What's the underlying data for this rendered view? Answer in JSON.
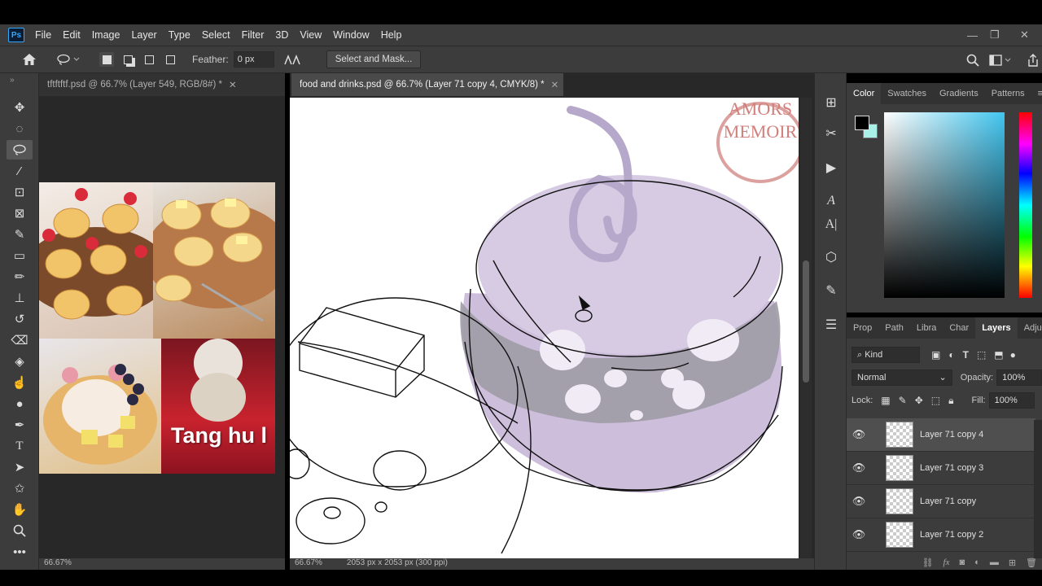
{
  "menubar": {
    "logo": "Ps",
    "items": [
      "File",
      "Edit",
      "Image",
      "Layer",
      "Type",
      "Select",
      "Filter",
      "3D",
      "View",
      "Window",
      "Help"
    ]
  },
  "options": {
    "feather_label": "Feather:",
    "feather_value": "0 px",
    "select_and_mask": "Select and Mask..."
  },
  "documents": {
    "doc1": {
      "tab_title": "tftftftf.psd @ 66.7% (Layer 549, RGB/8#) *",
      "photo_caption": "Tang hu l",
      "status_zoom": "66.67%"
    },
    "doc2": {
      "tab_title": "food and drinks.psd @ 66.7% (Layer 71 copy 4, CMYK/8) *",
      "status_zoom": "66.67%",
      "status_info": "2053 px x 2053 px (300 ppi)",
      "watermark_line1": "AMORS",
      "watermark_line2": "MEMOIR"
    }
  },
  "color_panel": {
    "tabs": [
      "Color",
      "Swatches",
      "Gradients",
      "Patterns"
    ],
    "active_tab": "Color",
    "foreground": "#000000",
    "background": "#a8f0e8"
  },
  "layers_panel": {
    "tabs": [
      "Prop",
      "Path",
      "Libra",
      "Char",
      "Layers",
      "Adjus"
    ],
    "active_tab": "Layers",
    "filter_kind": "Kind",
    "blend_mode": "Normal",
    "opacity_label": "Opacity:",
    "opacity_value": "100%",
    "lock_label": "Lock:",
    "fill_label": "Fill:",
    "fill_value": "100%",
    "layers": [
      {
        "name": "Layer 71 copy 4",
        "selected": true
      },
      {
        "name": "Layer 71 copy 3",
        "selected": false
      },
      {
        "name": "Layer 71 copy",
        "selected": false
      },
      {
        "name": "Layer 71 copy 2",
        "selected": false
      }
    ]
  }
}
